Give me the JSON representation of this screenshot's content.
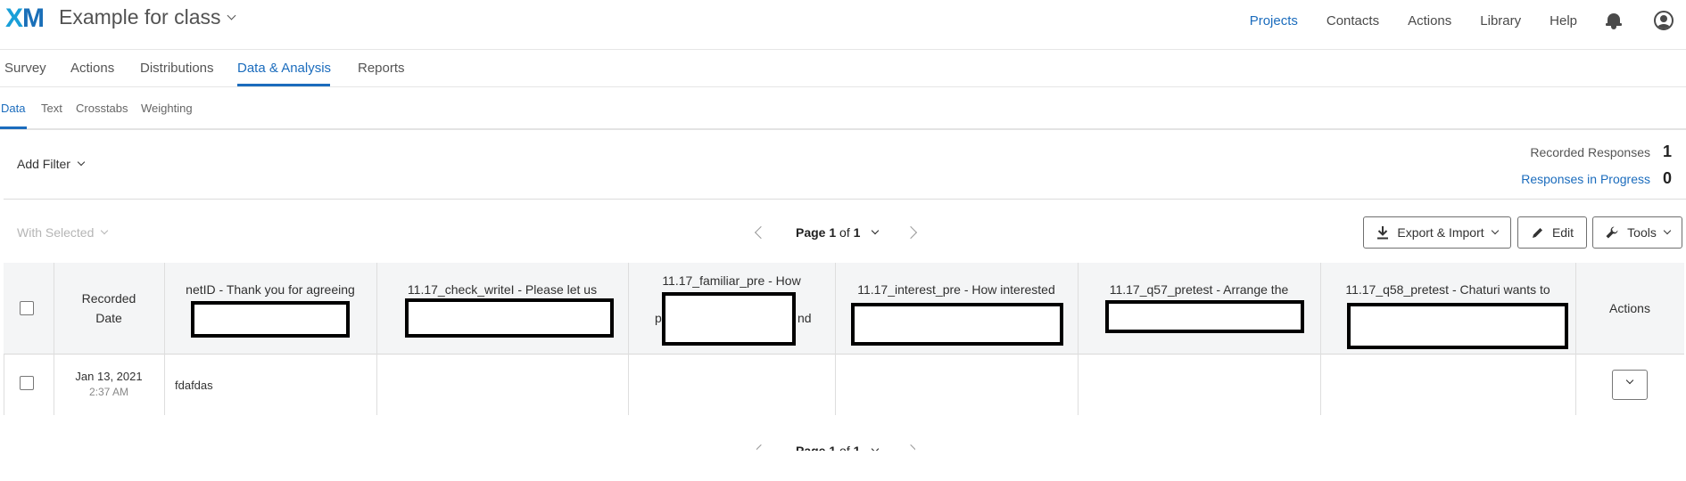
{
  "app": {
    "logo": {
      "x": "X",
      "m": "M"
    },
    "project_title": "Example for class"
  },
  "topnav": {
    "items": [
      "Projects",
      "Contacts",
      "Actions",
      "Library",
      "Help"
    ],
    "active": "Projects"
  },
  "main_tabs": {
    "items": [
      "Survey",
      "Actions",
      "Distributions",
      "Data & Analysis",
      "Reports"
    ],
    "active": "Data & Analysis"
  },
  "sub_tabs": {
    "items": [
      "Data",
      "Text",
      "Crosstabs",
      "Weighting"
    ],
    "active": "Data"
  },
  "filter": {
    "label": "Add Filter"
  },
  "summary": {
    "recorded_label": "Recorded Responses",
    "recorded_count": "1",
    "in_progress_label": "Responses in Progress",
    "in_progress_count": "0"
  },
  "toolbar": {
    "with_selected": "With Selected",
    "pager": {
      "prefix": "Page",
      "current": "1",
      "of": "of",
      "total": "1"
    },
    "export_label": "Export & Import",
    "edit_label": "Edit",
    "tools_label": "Tools"
  },
  "table": {
    "columns": [
      {
        "line1": "Recorded",
        "line2": "Date"
      },
      {
        "line1": "netID - Thank you for agreeing"
      },
      {
        "line1": "11.17_check_writeI - Please let us"
      },
      {
        "line1": "11.17_familiar_pre - How",
        "frag_left": "p",
        "frag_right": "nd"
      },
      {
        "line1": "11.17_interest_pre - How interested"
      },
      {
        "line1": "11.17_q57_pretest - Arrange the"
      },
      {
        "line1": "11.17_q58_pretest - Chaturi wants to"
      },
      {
        "line1": "Actions"
      }
    ],
    "rows": [
      {
        "date": "Jan 13, 2021",
        "time": "2:37 AM",
        "netid": "fdafdas"
      }
    ]
  },
  "colors": {
    "accent": "#1b6cbd",
    "logo_x": "#1a9fd8",
    "logo_m": "#1a6fb8"
  }
}
